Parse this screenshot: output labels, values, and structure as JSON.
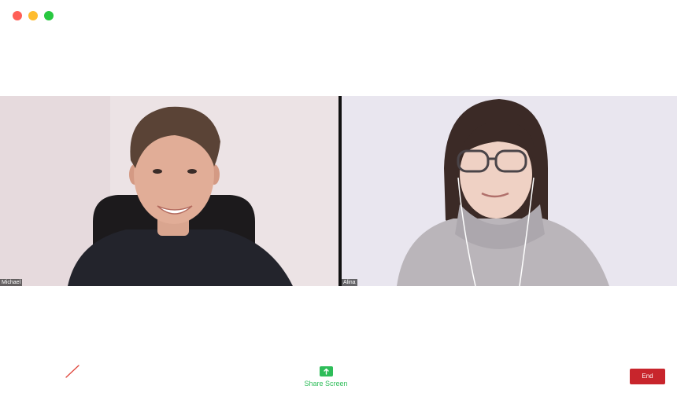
{
  "window": {
    "controls": [
      "close",
      "minimize",
      "zoom"
    ]
  },
  "participants": [
    {
      "name": "Michael"
    },
    {
      "name": "Alina"
    }
  ],
  "toolbar": {
    "mute_icon": "microphone-muted-slash-icon",
    "share_icon": "share-screen-arrow-up-icon",
    "share_label": "Share Screen",
    "end_label": "End"
  },
  "colors": {
    "accent_green": "#2ebd59",
    "end_red": "#c8252c",
    "mute_slash_red": "#e0453a"
  }
}
